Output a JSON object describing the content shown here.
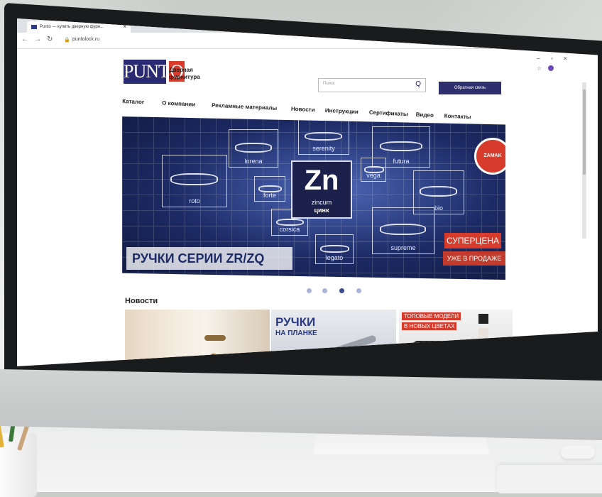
{
  "browser": {
    "tab_title": "Punto — купить дверную фурн...",
    "tab_close": "×",
    "new_tab": "+",
    "back": "←",
    "forward": "→",
    "reload": "↻",
    "url": "puntolock.ru",
    "win_minimize": "–",
    "win_maximize": "▫",
    "win_close": "×",
    "bookmark_star": "☆"
  },
  "site": {
    "logo": {
      "left": "PUNT",
      "o": "O"
    },
    "tagline_1": "Дверная",
    "tagline_2": "фурнитура",
    "search_placeholder": "Поиск",
    "search_icon": "Q",
    "feedback_button": "Обратная связь",
    "menu": [
      "Каталог",
      "О компании",
      "Рекламные материалы",
      "Новости",
      "Инструкции",
      "Сертификаты",
      "Видео",
      "Контакты"
    ]
  },
  "banner": {
    "element_symbol": "Zn",
    "element_name_latin": "zincum",
    "element_name_ru": "цинк",
    "tiles": [
      "roto",
      "lorena",
      "serenity",
      "futura",
      "bio",
      "supreme",
      "forte",
      "legato",
      "vega",
      "corsica"
    ],
    "badge": "ZAMAK",
    "series_title": "РУЧКИ СЕРИИ ZR/ZQ",
    "promo_price": "СУПЕРЦЕНА",
    "promo_sale": "УЖЕ В ПРОДАЖЕ",
    "slides_total": 4,
    "slide_active": 3
  },
  "news": {
    "heading": "Новости",
    "card2_title_1": "РУЧКИ",
    "card2_title_2": "НА ПЛАНКЕ",
    "card3_title_1": "ТОПОВЫЕ МОДЕЛИ",
    "card3_title_2": "В НОВЫХ ЦВЕТАХ"
  },
  "colors": {
    "brand_navy": "#2a2a72",
    "brand_red": "#d63b2c"
  }
}
